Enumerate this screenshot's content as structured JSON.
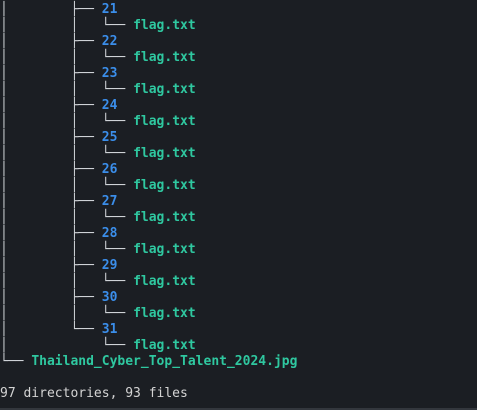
{
  "tree": {
    "entries": [
      {
        "dir": "21",
        "file": "flag.txt"
      },
      {
        "dir": "22",
        "file": "flag.txt"
      },
      {
        "dir": "23",
        "file": "flag.txt"
      },
      {
        "dir": "24",
        "file": "flag.txt"
      },
      {
        "dir": "25",
        "file": "flag.txt"
      },
      {
        "dir": "26",
        "file": "flag.txt"
      },
      {
        "dir": "27",
        "file": "flag.txt"
      },
      {
        "dir": "28",
        "file": "flag.txt"
      },
      {
        "dir": "29",
        "file": "flag.txt"
      },
      {
        "dir": "30",
        "file": "flag.txt"
      },
      {
        "dir": "31",
        "file": "flag.txt"
      }
    ],
    "image_file": "Thailand_Cyber_Top_Talent_2024.jpg",
    "summary": "97 directories, 93 files"
  },
  "colors": {
    "background": "#1b1e23",
    "directory": "#3b8eea",
    "file": "#2fc8a0",
    "text": "#d4d4d4"
  }
}
